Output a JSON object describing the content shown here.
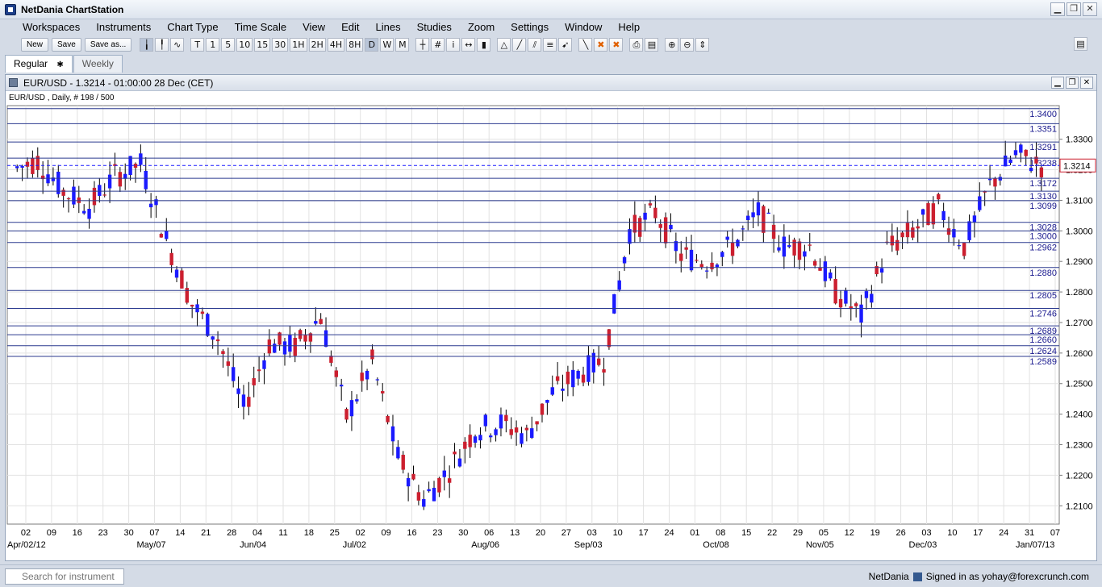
{
  "app": {
    "title": "NetDania ChartStation"
  },
  "menu": [
    "Workspaces",
    "Instruments",
    "Chart Type",
    "Time Scale",
    "View",
    "Edit",
    "Lines",
    "Studies",
    "Zoom",
    "Settings",
    "Window",
    "Help"
  ],
  "toolbar": {
    "new_label": "New",
    "save_label": "Save",
    "saveas_label": "Save as...",
    "period_buttons": [
      "T",
      "1",
      "5",
      "10",
      "15",
      "30",
      "1H",
      "2H",
      "4H",
      "8H",
      "D",
      "W",
      "M"
    ],
    "selected_period": "D"
  },
  "tabs": [
    {
      "label": "Regular",
      "active": true
    },
    {
      "label": "Weekly",
      "active": false
    }
  ],
  "chart_window": {
    "title": "EUR/USD - 1.3214 - 01:00:00  28 Dec (CET)",
    "subtitle": "EUR/USD , Daily, # 198 / 500"
  },
  "status": {
    "search_placeholder": "Search for instrument",
    "brand": "NetDania",
    "signed_in": "Signed in as yohay@forexcrunch.com"
  },
  "chart_data": {
    "type": "candlestick",
    "instrument": "EUR/USD",
    "last_price": 1.3214,
    "ylim": [
      1.204,
      1.341
    ],
    "y_ticks": [
      1.21,
      1.22,
      1.23,
      1.24,
      1.25,
      1.26,
      1.27,
      1.28,
      1.29,
      1.3,
      1.31,
      1.32,
      1.33
    ],
    "x_tick_labels": [
      "02",
      "09",
      "16",
      "23",
      "30",
      "07",
      "14",
      "21",
      "28",
      "04",
      "11",
      "18",
      "25",
      "02",
      "09",
      "16",
      "23",
      "30",
      "06",
      "13",
      "20",
      "27",
      "03",
      "10",
      "17",
      "24",
      "01",
      "08",
      "15",
      "22",
      "29",
      "05",
      "12",
      "19",
      "26",
      "03",
      "10",
      "17",
      "24",
      "31",
      "07"
    ],
    "x_month_labels": [
      {
        "label": "Apr/02/12",
        "at": 0
      },
      {
        "label": "May/07",
        "at": 5
      },
      {
        "label": "Jun/04",
        "at": 9
      },
      {
        "label": "Jul/02",
        "at": 13
      },
      {
        "label": "Aug/06",
        "at": 18
      },
      {
        "label": "Sep/03",
        "at": 22
      },
      {
        "label": "Oct/08",
        "at": 27
      },
      {
        "label": "Nov/05",
        "at": 31
      },
      {
        "label": "Dec/03",
        "at": 35
      },
      {
        "label": "Jan/07/13",
        "at": 40
      }
    ],
    "horizontal_lines": [
      1.34,
      1.3351,
      1.3291,
      1.3238,
      1.3172,
      1.313,
      1.3099,
      1.3028,
      1.3,
      1.2962,
      1.288,
      1.2805,
      1.2746,
      1.2689,
      1.266,
      1.2624,
      1.2589
    ],
    "horizontal_line_labels": [
      "1.3400",
      "1.3351",
      "1.3291",
      "1.3238",
      "1.3172",
      "1.3130",
      "1.3099",
      "1.3028",
      "1.3000",
      "1.2962",
      "1.2880",
      "1.2805",
      "1.2746",
      "1.2689",
      "1.2660",
      "1.2624",
      "1.2589"
    ],
    "colors": {
      "up": "#1a1aff",
      "down": "#cc1f2f",
      "lines": "#2b3a8f",
      "grid": "#e2e2e2"
    },
    "weekly_closes": [
      1.323,
      1.313,
      1.308,
      1.318,
      1.322,
      1.297,
      1.276,
      1.265,
      1.242,
      1.263,
      1.262,
      1.272,
      1.239,
      1.257,
      1.226,
      1.212,
      1.222,
      1.235,
      1.237,
      1.233,
      1.247,
      1.253,
      1.258,
      1.3,
      1.306,
      1.292,
      1.29,
      1.295,
      1.306,
      1.295,
      1.295,
      1.28,
      1.272,
      1.294,
      1.3,
      1.308,
      1.295,
      1.315,
      1.325,
      1.3214
    ]
  }
}
